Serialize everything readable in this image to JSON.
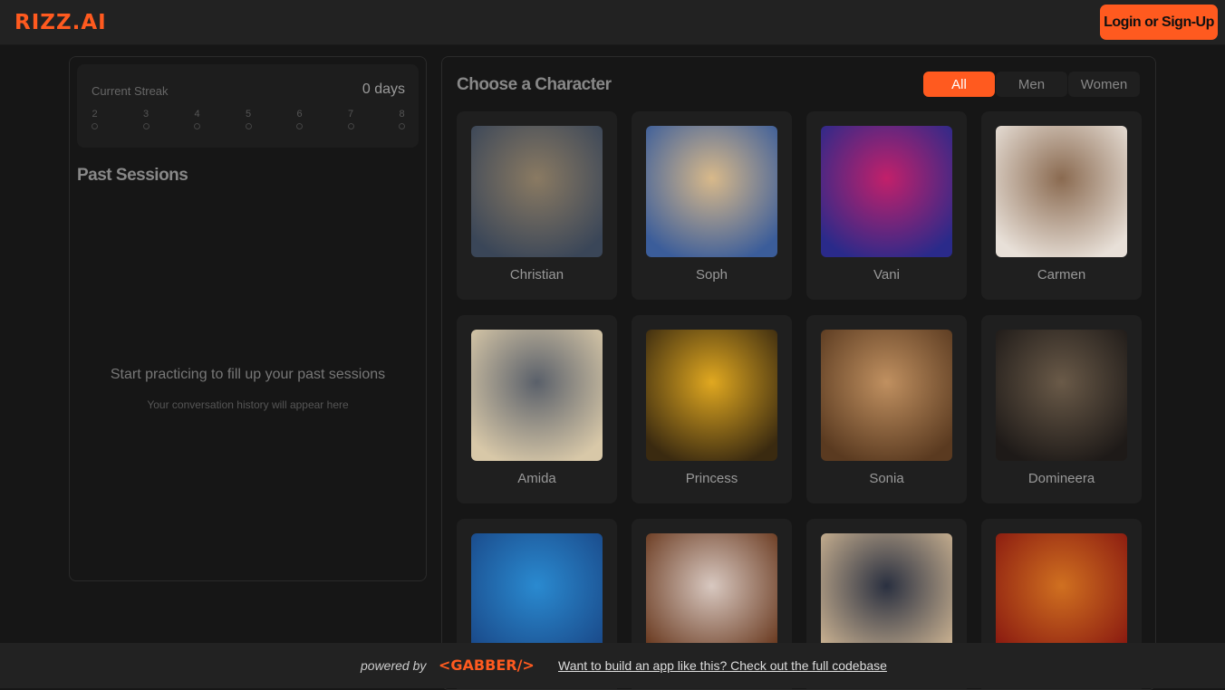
{
  "header": {
    "logo": "RIZZ.AI",
    "login_label": "Login or Sign-Up"
  },
  "streak": {
    "label": "Current Streak",
    "value": "0 days",
    "days": [
      "2",
      "3",
      "4",
      "5",
      "6",
      "7",
      "8"
    ]
  },
  "past_sessions": {
    "title": "Past Sessions",
    "empty_title": "Start practicing to fill up your past sessions",
    "empty_subtitle": "Your conversation history will appear here"
  },
  "characters": {
    "title": "Choose a Character",
    "tabs": [
      "All",
      "Men",
      "Women"
    ],
    "active_tab": "All",
    "items": [
      {
        "name": "Christian",
        "colors": [
          "#8a7a62",
          "#3a4658"
        ]
      },
      {
        "name": "Soph",
        "colors": [
          "#d8b98a",
          "#3b5d9a"
        ]
      },
      {
        "name": "Vani",
        "colors": [
          "#c2206a",
          "#2a2a8a"
        ]
      },
      {
        "name": "Carmen",
        "colors": [
          "#8a6a50",
          "#e8e0d8"
        ]
      },
      {
        "name": "Amida",
        "colors": [
          "#5a606a",
          "#d8c8a8"
        ]
      },
      {
        "name": "Princess",
        "colors": [
          "#e0a820",
          "#3a2a10"
        ]
      },
      {
        "name": "Sonia",
        "colors": [
          "#c09060",
          "#5a3a20"
        ]
      },
      {
        "name": "Domineera",
        "colors": [
          "#6a5a48",
          "#1e1a18"
        ]
      },
      {
        "name": "",
        "colors": [
          "#2a8ad0",
          "#1a4a8a"
        ]
      },
      {
        "name": "",
        "colors": [
          "#d8c8c0",
          "#6a3a20"
        ]
      },
      {
        "name": "",
        "colors": [
          "#2a3040",
          "#c8b090"
        ]
      },
      {
        "name": "",
        "colors": [
          "#d07020",
          "#8a1a10"
        ]
      }
    ]
  },
  "footer": {
    "powered_by": "powered by",
    "brand": "<GABBER/>",
    "cta": "Want to build an app like this? Check out the full codebase"
  }
}
